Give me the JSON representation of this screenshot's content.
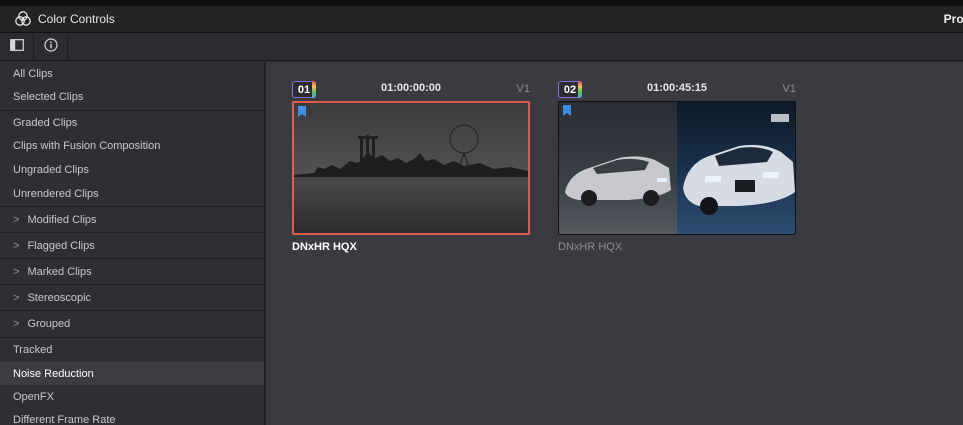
{
  "window": {
    "title": "Color Controls",
    "right_title": "Proj"
  },
  "toolbar": {
    "buttons": [
      {
        "icon": "sidebar-toggle-icon"
      },
      {
        "icon": "info-icon"
      }
    ]
  },
  "sidebar": {
    "items": [
      {
        "label": "All Clips",
        "chevron": ""
      },
      {
        "label": "Selected Clips",
        "chevron": ""
      },
      {
        "label": "Graded Clips",
        "chevron": ""
      },
      {
        "label": "Clips with Fusion Composition",
        "chevron": ""
      },
      {
        "label": "Ungraded Clips",
        "chevron": ""
      },
      {
        "label": "Unrendered Clips",
        "chevron": ""
      },
      {
        "label": "Modified Clips",
        "chevron": ">"
      },
      {
        "label": "Flagged Clips",
        "chevron": ">"
      },
      {
        "label": "Marked Clips",
        "chevron": ">"
      },
      {
        "label": "Stereoscopic",
        "chevron": ">"
      },
      {
        "label": "Grouped",
        "chevron": ">"
      },
      {
        "label": "Tracked",
        "chevron": ""
      },
      {
        "label": "Noise Reduction",
        "chevron": ""
      },
      {
        "label": "OpenFX",
        "chevron": ""
      },
      {
        "label": "Different Frame Rate",
        "chevron": ""
      }
    ],
    "active": "Noise Reduction"
  },
  "clips": [
    {
      "number": "01",
      "timecode": "01:00:00:00",
      "track": "V1",
      "name": "DNxHR HQX",
      "selected": true
    },
    {
      "number": "02",
      "timecode": "01:00:45:15",
      "track": "V1",
      "name": "DNxHR HQX",
      "selected": false
    }
  ],
  "colors": {
    "selection": "#e35a4f",
    "flag": "#3d8fe3",
    "badge_border": "#8f6de0"
  }
}
